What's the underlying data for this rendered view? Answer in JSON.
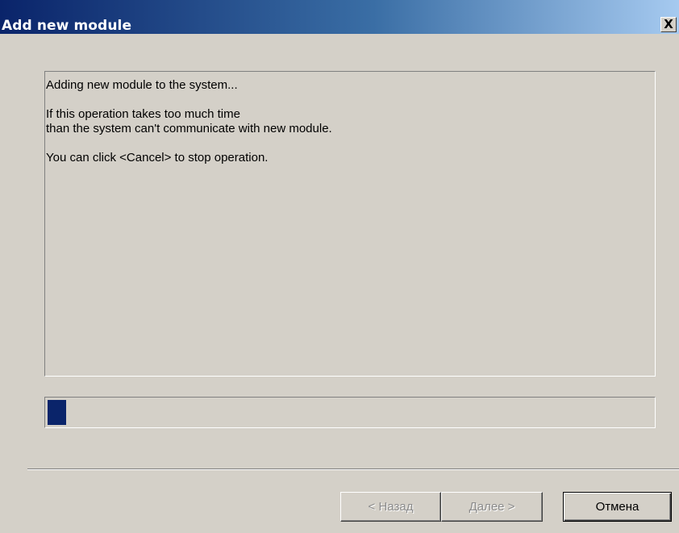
{
  "window": {
    "title": "Add new module",
    "close_glyph": "X"
  },
  "message": {
    "lines": [
      "Adding new module to the system...",
      "",
      "If this operation takes too much time",
      "than the system can't communicate with new module.",
      "",
      "You can click <Cancel> to stop operation."
    ]
  },
  "progress": {
    "value_percent": 3,
    "fill_color": "#0a246a"
  },
  "buttons": {
    "back_label": "< Назад",
    "next_label": "Далее >",
    "cancel_label": "Отмена"
  },
  "colors": {
    "title_gradient_start": "#0a246a",
    "title_gradient_end": "#a6caf0",
    "dialog_background": "#d4d0c8"
  }
}
